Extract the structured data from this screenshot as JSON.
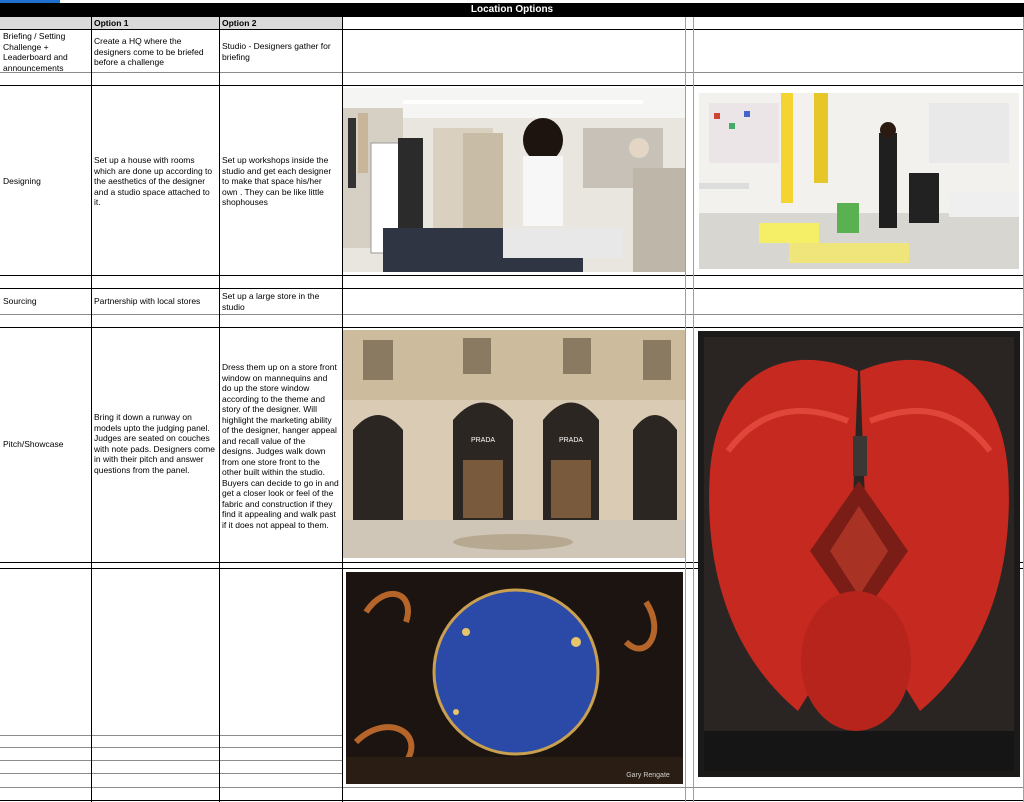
{
  "sheet": {
    "title": "Location Options",
    "headers": {
      "option1": "Option 1",
      "option2": "Option 2"
    },
    "rows": [
      {
        "label": "Briefing / Setting Challenge + Leaderboard and announcements",
        "option1": "Create a HQ where the designers come to be briefed before a challenge",
        "option2": "Studio - Designers gather for briefing"
      },
      {
        "label": "Designing",
        "option1": "Set up a house with rooms which are done up according to the aesthetics of the designer and a studio space attached to it.",
        "option2": "Set up workshops inside the studio and get each designer to make that space his/her own . They can be like little shophouses"
      },
      {
        "label": "Sourcing",
        "option1": "Partnership with local stores",
        "option2": "Set up a large store in the studio"
      },
      {
        "label": "Pitch/Showcase",
        "option1": "Bring it down a runway on models upto the judging panel. Judges are seated on couches with note pads. Designers come in with their pitch and answer questions from the panel.",
        "option2": "Dress them up on a store front window on mannequins and do up the store window according to the theme and story of the designer.  Will highlight the marketing ability of the designer, hanger appeal and recall value of the designs. Judges walk down from one store front to the other built within the studio. Buyers can decide to go in and get a closer look or feel of the fabric and construction if they find it appealing and walk past if it does not appeal to them."
      }
    ],
    "images": {
      "designing_1": {
        "icon": "design-studio-photo"
      },
      "designing_2": {
        "icon": "design-workshop-photo"
      },
      "pitch_storefront": {
        "icon": "prada-storefront-photo",
        "sign": "PRADA"
      },
      "pitch_moon_window": {
        "icon": "moon-window-display-photo",
        "watermark": "Gary Rengate"
      },
      "pitch_wings_window": {
        "icon": "red-wings-window-display-photo"
      }
    },
    "colors": {
      "title_bg": "#000000",
      "header_bg": "#d9d9d9",
      "accent": "#1f6fd1"
    }
  }
}
